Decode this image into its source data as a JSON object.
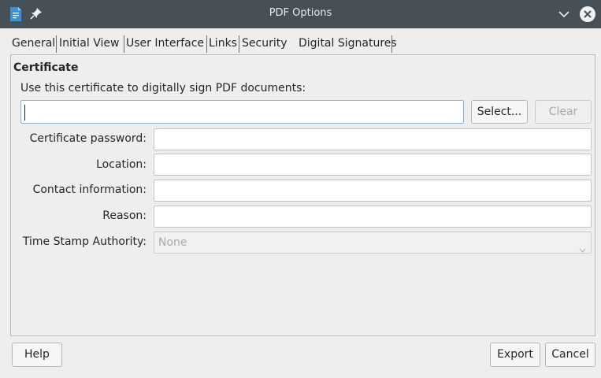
{
  "window": {
    "title": "PDF Options"
  },
  "tabs": [
    {
      "label": "General"
    },
    {
      "label": "Initial View"
    },
    {
      "label": "User Interface"
    },
    {
      "label": "Links"
    },
    {
      "label": "Security"
    },
    {
      "label": "Digital Signatures"
    }
  ],
  "certificate": {
    "section_title": "Certificate",
    "use_label": "Use this certificate to digitally sign PDF documents:",
    "certificate_value": "",
    "select_button": "Select...",
    "clear_button": "Clear",
    "password_label": "Certificate password:",
    "password_value": "",
    "location_label": "Location:",
    "location_value": "",
    "contact_label": "Contact information:",
    "contact_value": "",
    "reason_label": "Reason:",
    "reason_value": "",
    "tsa_label": "Time Stamp Authority:",
    "tsa_value": "None"
  },
  "footer": {
    "help_button": "Help",
    "export_button": "Export",
    "cancel_button": "Cancel"
  },
  "colors": {
    "titlebar": "#475057",
    "window_bg": "#efeeec",
    "focus_border": "#7fb4d8"
  },
  "icons": [
    "document-icon",
    "pin-icon",
    "minimize-chevron-icon",
    "close-icon",
    "chevron-down-icon"
  ]
}
